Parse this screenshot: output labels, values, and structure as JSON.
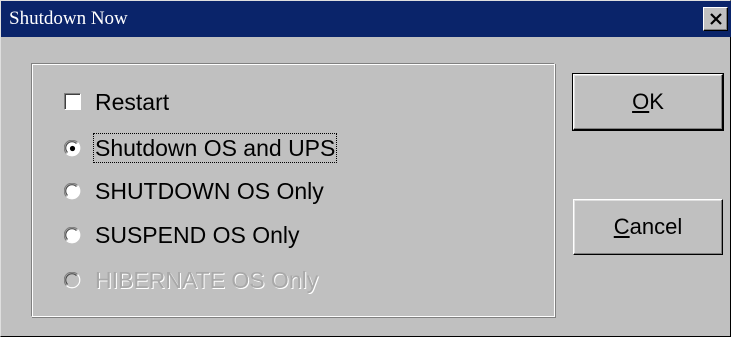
{
  "window": {
    "title": "Shutdown Now",
    "close_glyph": "close-icon"
  },
  "options": {
    "restart": {
      "label": "Restart",
      "checked": false
    },
    "radios": [
      {
        "label": "Shutdown OS and UPS",
        "selected": true,
        "enabled": true
      },
      {
        "label": "SHUTDOWN OS Only",
        "selected": false,
        "enabled": true
      },
      {
        "label": "SUSPEND OS Only",
        "selected": false,
        "enabled": true
      },
      {
        "label": "HIBERNATE OS Only",
        "selected": false,
        "enabled": false
      }
    ]
  },
  "buttons": {
    "ok": {
      "accel": "O",
      "rest": "K"
    },
    "cancel": {
      "accel": "C",
      "rest": "ancel"
    }
  },
  "colors": {
    "titlebar": "#0a246a",
    "face": "#c0c0c0",
    "disabled_text": "#a9a9a9"
  }
}
